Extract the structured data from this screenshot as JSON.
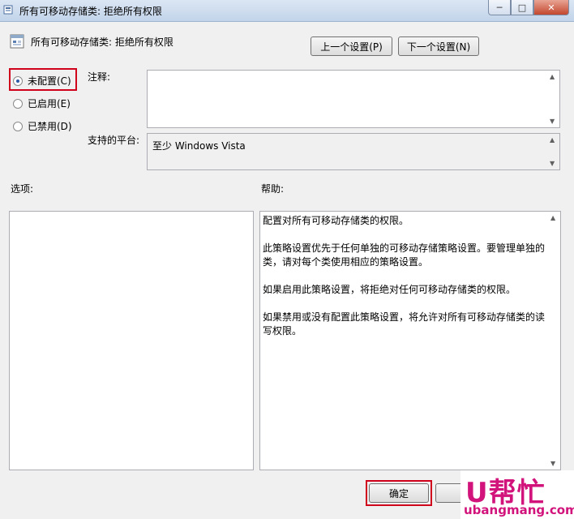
{
  "window": {
    "title": "所有可移动存储类: 拒绝所有权限",
    "controls": [
      "minimize-icon",
      "maximize-icon",
      "close-icon"
    ]
  },
  "header": {
    "policy_title": "所有可移动存储类: 拒绝所有权限",
    "prev_button": "上一个设置(P)",
    "next_button": "下一个设置(N)"
  },
  "state": {
    "options": [
      {
        "label": "未配置(C)",
        "checked": true
      },
      {
        "label": "已启用(E)",
        "checked": false
      },
      {
        "label": "已禁用(D)",
        "checked": false
      }
    ]
  },
  "comment": {
    "label": "注释:",
    "value": ""
  },
  "platform": {
    "label": "支持的平台:",
    "value": "至少 Windows Vista"
  },
  "options_label": "选项:",
  "help": {
    "label": "帮助:",
    "paragraphs": [
      "配置对所有可移动存储类的权限。",
      "此策略设置优先于任何单独的可移动存储策略设置。要管理单独的类，请对每个类使用相应的策略设置。",
      "如果启用此策略设置，将拒绝对任何可移动存储类的权限。",
      "如果禁用或没有配置此策略设置，将允许对所有可移动存储类的读写权限。"
    ]
  },
  "footer": {
    "ok_button": "确定",
    "cancel_button": "取"
  },
  "watermark": {
    "brand": "U帮忙",
    "url": "ubangmang.com"
  },
  "colors": {
    "highlight": "#d0021b",
    "watermark": "#d1137b"
  }
}
